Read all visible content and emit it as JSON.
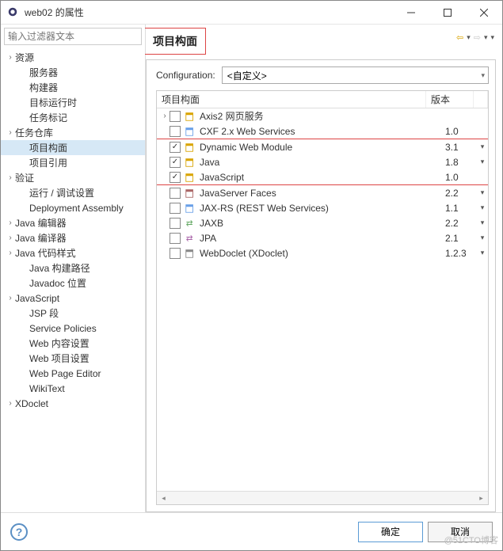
{
  "window": {
    "title": "web02 的属性"
  },
  "filter": {
    "placeholder": "输入过滤器文本"
  },
  "tree": [
    {
      "label": "资源",
      "exp": true,
      "level": 0
    },
    {
      "label": "服务器",
      "level": 1
    },
    {
      "label": "构建器",
      "level": 1
    },
    {
      "label": "目标运行时",
      "level": 1
    },
    {
      "label": "任务标记",
      "level": 1
    },
    {
      "label": "任务仓库",
      "exp": true,
      "level": 0
    },
    {
      "label": "项目构面",
      "level": 1,
      "selected": true
    },
    {
      "label": "项目引用",
      "level": 1
    },
    {
      "label": "验证",
      "exp": true,
      "level": 0
    },
    {
      "label": "运行 / 调试设置",
      "level": 1
    },
    {
      "label": "Deployment Assembly",
      "level": 1
    },
    {
      "label": "Java 编辑器",
      "exp": true,
      "level": 0
    },
    {
      "label": "Java 编译器",
      "exp": true,
      "level": 0
    },
    {
      "label": "Java 代码样式",
      "exp": true,
      "level": 0
    },
    {
      "label": "Java 构建路径",
      "level": 1
    },
    {
      "label": "Javadoc 位置",
      "level": 1
    },
    {
      "label": "JavaScript",
      "exp": true,
      "level": 0
    },
    {
      "label": "JSP 段",
      "level": 1
    },
    {
      "label": "Service Policies",
      "level": 1
    },
    {
      "label": "Web 内容设置",
      "level": 1
    },
    {
      "label": "Web 项目设置",
      "level": 1
    },
    {
      "label": "Web Page Editor",
      "level": 1
    },
    {
      "label": "WikiText",
      "level": 1
    },
    {
      "label": "XDoclet",
      "exp": true,
      "level": 0
    }
  ],
  "page": {
    "title": "项目构面",
    "config_label": "Configuration:",
    "config_value": "<自定义>",
    "col_name": "项目构面",
    "col_ver": "版本"
  },
  "facets": [
    {
      "label": "Axis2 网页服务",
      "checked": false,
      "expand": true,
      "icon": "folder",
      "ver": "",
      "drop": false
    },
    {
      "label": "CXF 2.x Web Services",
      "checked": false,
      "icon": "cxf",
      "ver": "1.0",
      "drop": false
    },
    {
      "label": "Dynamic Web Module",
      "checked": true,
      "icon": "web",
      "ver": "3.1",
      "drop": true,
      "hi": true
    },
    {
      "label": "Java",
      "checked": true,
      "icon": "java",
      "ver": "1.8",
      "drop": true,
      "hi": true
    },
    {
      "label": "JavaScript",
      "checked": true,
      "icon": "js",
      "ver": "1.0",
      "drop": false,
      "hi": true
    },
    {
      "label": "JavaServer Faces",
      "checked": false,
      "icon": "jsf",
      "ver": "2.2",
      "drop": true
    },
    {
      "label": "JAX-RS (REST Web Services)",
      "checked": false,
      "icon": "jax",
      "ver": "1.1",
      "drop": true
    },
    {
      "label": "JAXB",
      "checked": false,
      "icon": "jaxb",
      "ver": "2.2",
      "drop": true
    },
    {
      "label": "JPA",
      "checked": false,
      "icon": "jpa",
      "ver": "2.1",
      "drop": true
    },
    {
      "label": "WebDoclet (XDoclet)",
      "checked": false,
      "icon": "xdoc",
      "ver": "1.2.3",
      "drop": true
    }
  ],
  "buttons": {
    "ok": "确定",
    "cancel": "取消"
  },
  "watermark": "@51CTO博客"
}
